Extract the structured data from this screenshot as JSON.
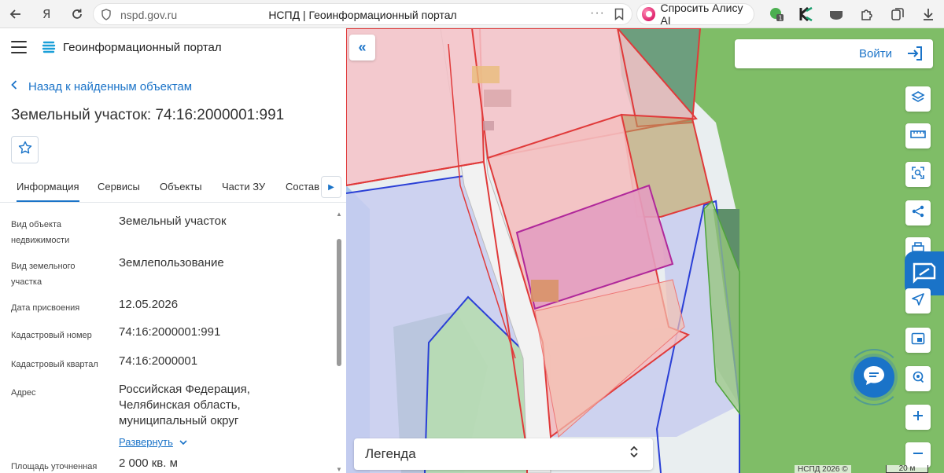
{
  "browser": {
    "url": "nspd.gov.ru",
    "tab_title": "НСПД | Геоинформационный портал",
    "alice_label": "Спросить Алису AI"
  },
  "app": {
    "title": "Геоинформационный портал",
    "back_label": "Назад к найденным объектам",
    "object_title": "Земельный участок: 74:16:2000001:991"
  },
  "tabs": [
    "Информация",
    "Сервисы",
    "Объекты",
    "Части ЗУ",
    "Состав"
  ],
  "info": [
    {
      "label": "Вид объекта недвижимости",
      "value": "Земельный участок"
    },
    {
      "label": "Вид земельного участка",
      "value": "Землепользование"
    },
    {
      "label": "Дата присвоения",
      "value": "12.05.2026"
    },
    {
      "label": "Кадастровый номер",
      "value": "74:16:2000001:991"
    },
    {
      "label": "Кадастровый квартал",
      "value": "74:16:2000001"
    },
    {
      "label": "Адрес",
      "value": "Российская Федерация, Челябинская область, муниципальный округ"
    },
    {
      "label": "Площадь уточненная",
      "value": "2 000 кв. м"
    }
  ],
  "expand_label": "Развернуть",
  "map": {
    "login_label": "Войти",
    "legend_label": "Легенда",
    "attribution": "НСПД 2026 ©",
    "scale_label": "20 м",
    "colors": {
      "accent": "#1a73c8",
      "parcel_red": "#e03a3a",
      "selected": "#b0289a",
      "zone_blue": "#2a3fd6",
      "forest_green": "#7bbf63"
    }
  },
  "tools": [
    "layers-icon",
    "ruler-icon",
    "select-area-icon",
    "share-icon",
    "print-icon",
    "navigate-icon",
    "frame-icon",
    "location-search-icon",
    "zoom-in-icon",
    "zoom-out-icon"
  ]
}
